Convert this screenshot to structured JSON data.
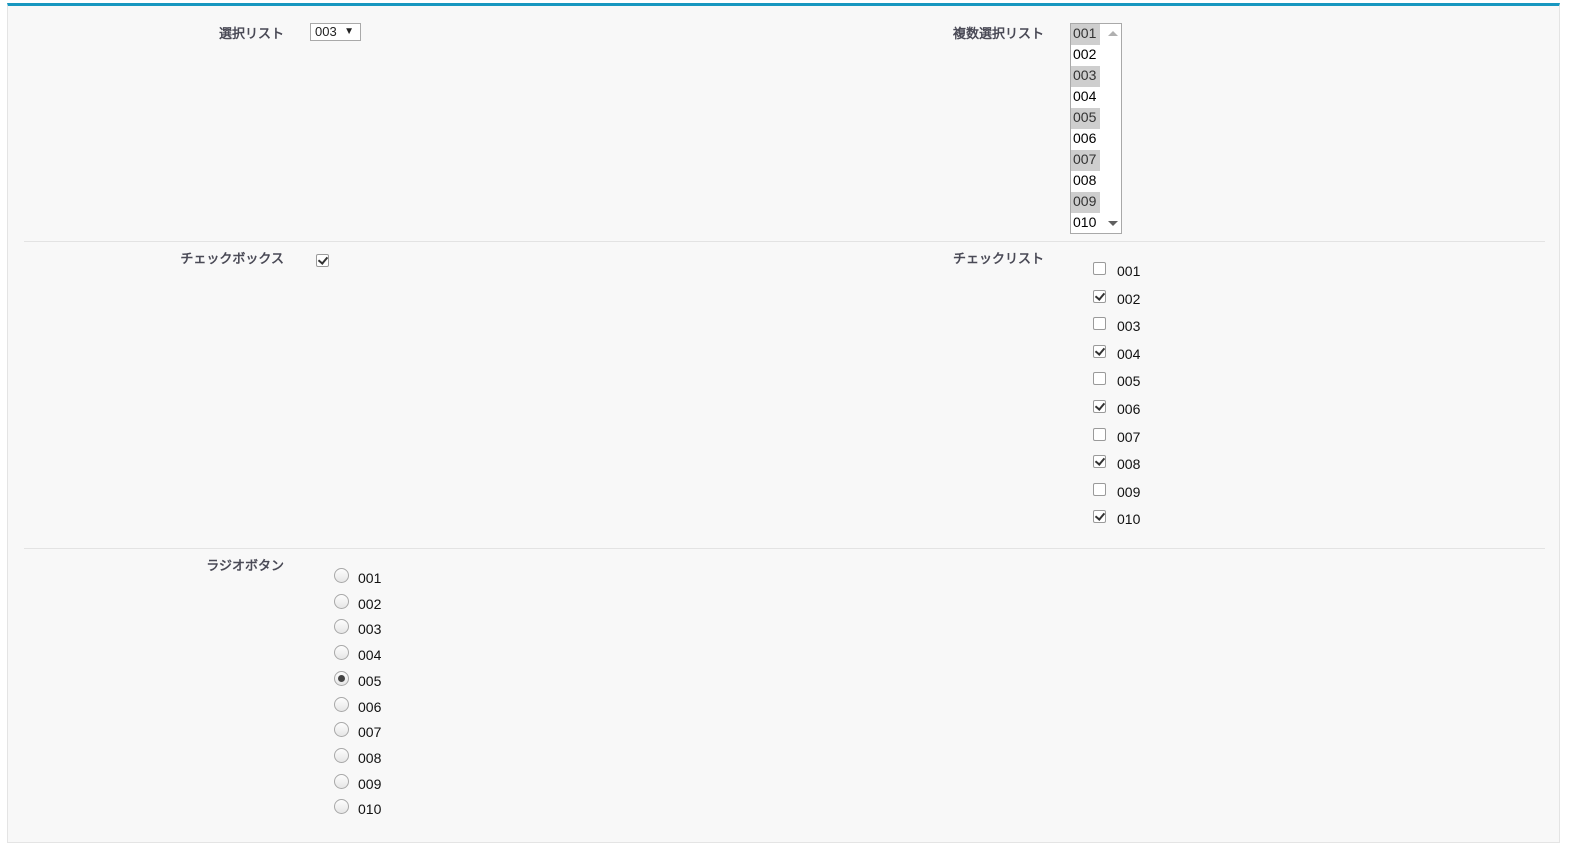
{
  "select_field": {
    "label": "選択リスト",
    "value": "003"
  },
  "multi_select_field": {
    "label": "複数選択リスト",
    "options": [
      {
        "text": "001",
        "selected": true
      },
      {
        "text": "002",
        "selected": false
      },
      {
        "text": "003",
        "selected": true
      },
      {
        "text": "004",
        "selected": false
      },
      {
        "text": "005",
        "selected": true
      },
      {
        "text": "006",
        "selected": false
      },
      {
        "text": "007",
        "selected": true
      },
      {
        "text": "008",
        "selected": false
      },
      {
        "text": "009",
        "selected": true
      },
      {
        "text": "010",
        "selected": false
      }
    ]
  },
  "checkbox_field": {
    "label": "チェックボックス",
    "checked": true
  },
  "checklist_field": {
    "label": "チェックリスト",
    "items": [
      {
        "text": "001",
        "checked": false
      },
      {
        "text": "002",
        "checked": true
      },
      {
        "text": "003",
        "checked": false
      },
      {
        "text": "004",
        "checked": true
      },
      {
        "text": "005",
        "checked": false
      },
      {
        "text": "006",
        "checked": true
      },
      {
        "text": "007",
        "checked": false
      },
      {
        "text": "008",
        "checked": true
      },
      {
        "text": "009",
        "checked": false
      },
      {
        "text": "010",
        "checked": true
      }
    ]
  },
  "radio_field": {
    "label": "ラジオボタン",
    "selected": "005",
    "items": [
      "001",
      "002",
      "003",
      "004",
      "005",
      "006",
      "007",
      "008",
      "009",
      "010"
    ]
  },
  "colors": {
    "accent": "#1797c0",
    "panel_bg": "#f8f8f8",
    "label": "#4a4a56"
  }
}
